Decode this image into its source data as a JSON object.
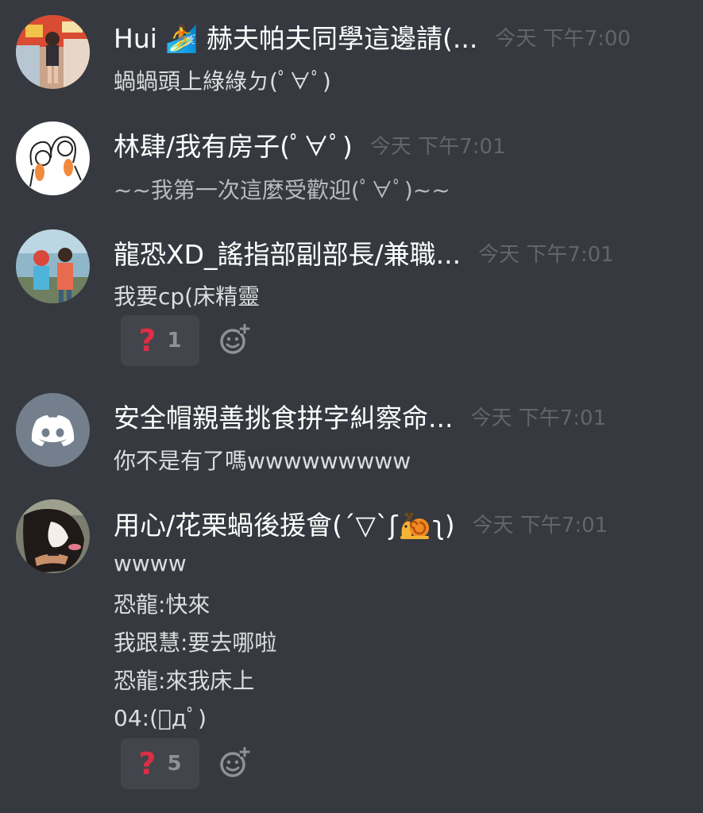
{
  "messages": [
    {
      "author": "Hui 🏄 赫夫帕夫同學這邊請(ﾟ∀ﾟ)",
      "author_display": "Hui 🏄 赫夫帕夫同學這邊請(...",
      "time": "今天 下午7:00",
      "lines": [
        "蝸蝸頭上綠綠ㄉ(ﾟ∀ﾟ)"
      ]
    },
    {
      "author": "林肆/我有房子(ﾟ∀ﾟ)",
      "time": "今天 下午7:01",
      "lines": [
        "~~我第一次這麼受歡迎(ﾟ∀ﾟ)~~"
      ]
    },
    {
      "author": "龍恐XD_謠指部副部長/兼職...",
      "time": "今天 下午7:01",
      "lines": [
        "我要cp(床精靈"
      ],
      "reaction": {
        "emoji": "?",
        "count": "1"
      }
    },
    {
      "author": "安全帽親善挑食拼字糾察命...",
      "time": "今天 下午7:01",
      "lines": [
        "你不是有了嗎wwwwwwwww"
      ]
    },
    {
      "author_prefix": "用心/花栗蝸後援會(´▽`ʃ",
      "author_suffix": "ʅ)",
      "time": "今天 下午7:01",
      "lines": [
        "wwww",
        "恐龍:快來",
        "我跟慧:要去哪啦",
        "恐龍:來我床上",
        "04:(ﾟдﾟ)"
      ],
      "reaction": {
        "emoji": "?",
        "count": "5"
      }
    }
  ],
  "icons": {
    "add_reaction": "add-reaction-icon",
    "discord_default_avatar": "discord-logo-icon"
  },
  "colors": {
    "background": "#36393f",
    "username": "#ffffff",
    "timestamp": "#62656b",
    "text": "#dcddde",
    "reaction_bg": "#42454c",
    "reaction_emoji": "#dd2e44",
    "discord_avatar": "#747f8d"
  }
}
